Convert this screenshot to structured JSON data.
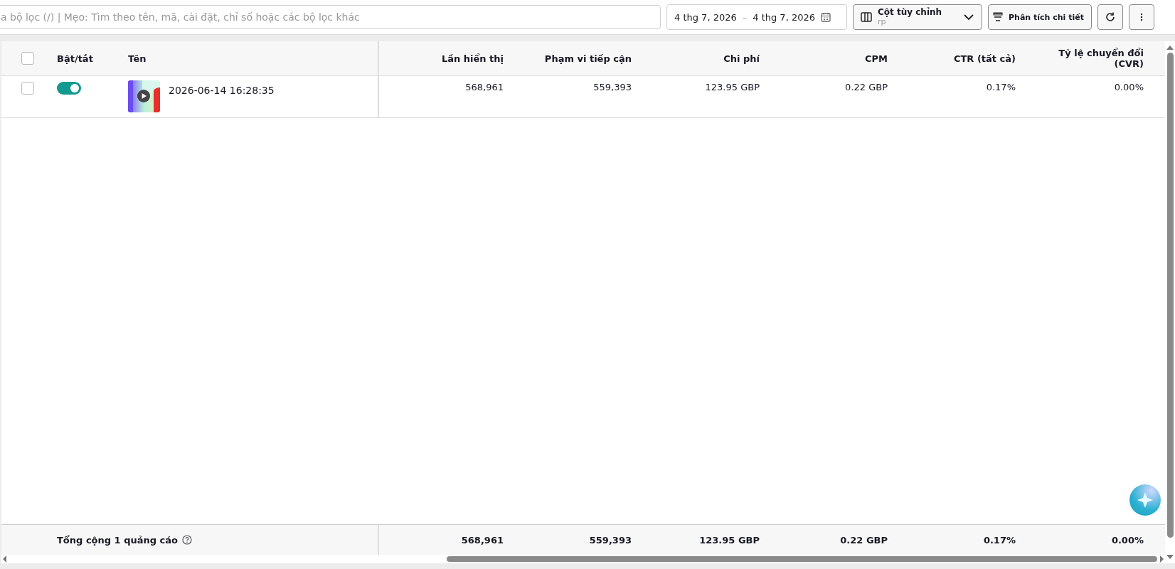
{
  "toolbar": {
    "search": {
      "placeholder": "a bộ lọc (/) | Mẹo: Tìm theo tên, mã, cài đặt, chỉ số hoặc các bộ lọc khác"
    },
    "date_range": {
      "start": "4 thg 7, 2026",
      "separator": "–",
      "end": "4 thg 7, 2026"
    },
    "columns_button": {
      "label": "Cột tùy chỉnh",
      "sublabel": "rp"
    },
    "breakdown_button": {
      "label": "Phân tích chi tiết"
    }
  },
  "table": {
    "header_checkbox": {
      "checked": false
    },
    "columns": [
      {
        "label": "Bật/tắt",
        "kind": "toggle"
      },
      {
        "label": "Tên",
        "kind": "name"
      },
      {
        "label": "Lần hiển thị",
        "kind": "metric"
      },
      {
        "label": "Phạm vi tiếp cận",
        "kind": "metric"
      },
      {
        "label": "Chi phí",
        "kind": "metric"
      },
      {
        "label": "CPM",
        "kind": "metric"
      },
      {
        "label": "CTR (tất cả)",
        "kind": "metric"
      },
      {
        "label": "Tỷ lệ chuyển đổi\n(CVR)",
        "kind": "metric"
      }
    ],
    "rows": [
      {
        "checked": false,
        "on": true,
        "name": "2026-06-14 16:28:35",
        "metrics": [
          "568,961",
          "559,393",
          "123.95 GBP",
          "0.22 GBP",
          "0.17%",
          "0.00%"
        ]
      }
    ],
    "footer": {
      "label": "Tổng cộng 1 quảng cáo",
      "metrics": [
        "568,961",
        "559,393",
        "123.95 GBP",
        "0.22 GBP",
        "0.17%",
        "0.00%"
      ]
    }
  }
}
